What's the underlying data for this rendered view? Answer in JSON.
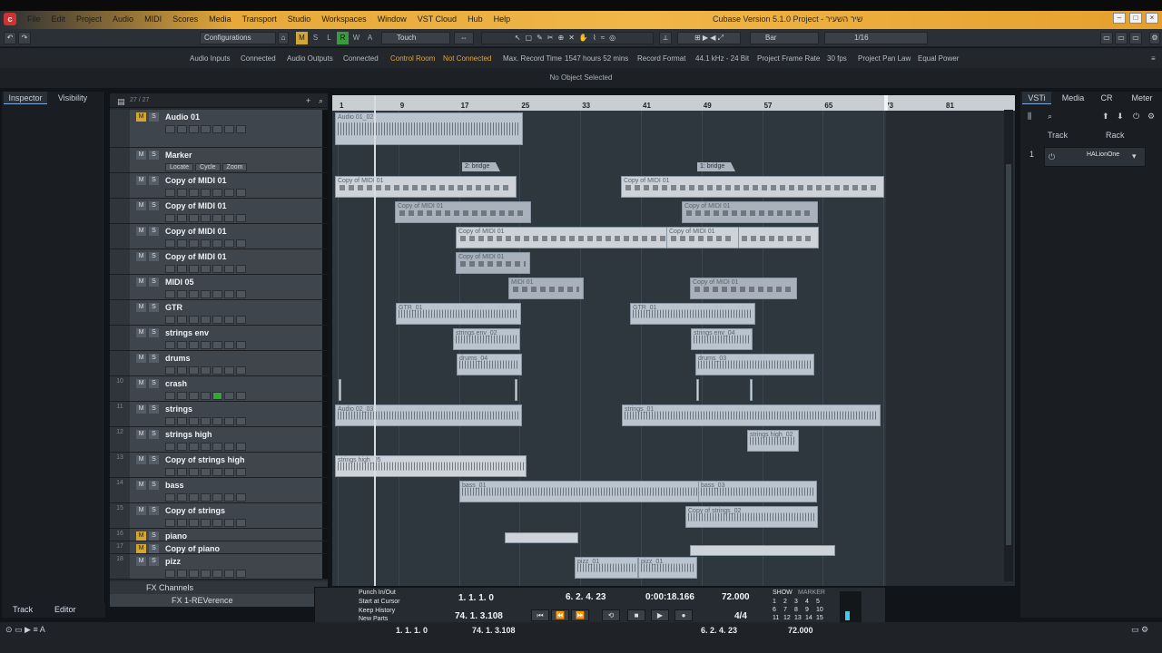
{
  "window": {
    "title": "Cubase Version 5.1.0 Project - שיר השעיר",
    "app_icon": "cubase-icon"
  },
  "menu": [
    "File",
    "Edit",
    "Project",
    "Audio",
    "MIDI",
    "Scores",
    "Media",
    "Transport",
    "Studio",
    "Workspaces",
    "Window",
    "VST Cloud",
    "Hub",
    "Help"
  ],
  "toolbar": {
    "configurations": "Configurations",
    "toggles": [
      "M",
      "S",
      "L",
      "R",
      "W",
      "A"
    ],
    "automation_mode": "Touch",
    "grid_type": "Bar",
    "quantize": "1/16"
  },
  "status": {
    "audio_inputs_label": "Audio Inputs",
    "audio_inputs_value": "Connected",
    "audio_outputs_label": "Audio Outputs",
    "audio_outputs_value": "Connected",
    "control_room_label": "Control Room",
    "control_room_value": "Not Connected",
    "max_record_label": "Max. Record Time",
    "max_record_value": "1547 hours 52 mins",
    "record_format_label": "Record Format",
    "record_format_value": "44.1 kHz - 24 Bit",
    "frame_rate_label": "Project Frame Rate",
    "frame_rate_value": "30 fps",
    "pan_law_label": "Project Pan Law",
    "pan_law_value": "Equal Power",
    "info": "No Object Selected"
  },
  "left_zone": {
    "tabs": [
      "Inspector",
      "Visibility"
    ],
    "bottom_tabs": [
      "Track",
      "Editor"
    ]
  },
  "track_list": {
    "count": "27 / 27",
    "tracks": [
      {
        "num": "",
        "name": "Audio 01",
        "m_on": true
      },
      {
        "num": "",
        "name": "Marker",
        "m_on": false
      },
      {
        "num": "",
        "name": "Copy of MIDI 01",
        "m_on": false
      },
      {
        "num": "",
        "name": "Copy of MIDI 01",
        "m_on": false
      },
      {
        "num": "",
        "name": "Copy of MIDI 01",
        "m_on": false
      },
      {
        "num": "",
        "name": "Copy of MIDI 01",
        "m_on": false
      },
      {
        "num": "",
        "name": "MIDI 05",
        "m_on": false
      },
      {
        "num": "",
        "name": "GTR",
        "m_on": false
      },
      {
        "num": "",
        "name": "strings env",
        "m_on": false
      },
      {
        "num": "",
        "name": "drums",
        "m_on": false
      },
      {
        "num": "10",
        "name": "crash",
        "m_on": false
      },
      {
        "num": "11",
        "name": "strings",
        "m_on": false
      },
      {
        "num": "12",
        "name": "strings high",
        "m_on": false
      },
      {
        "num": "13",
        "name": "Copy of strings high",
        "m_on": false
      },
      {
        "num": "14",
        "name": "bass",
        "m_on": false
      },
      {
        "num": "15",
        "name": "Copy of strings",
        "m_on": false
      },
      {
        "num": "16",
        "name": "piano",
        "m_on": true
      },
      {
        "num": "17",
        "name": "Copy of piano",
        "m_on": true
      },
      {
        "num": "18",
        "name": "pizz",
        "m_on": false
      }
    ],
    "marker_buttons": [
      "Locate",
      "Cycle",
      "Zoom"
    ],
    "folder_fx": "FX Channels",
    "fx_track": "FX 1-REVerence"
  },
  "ruler": [
    "1",
    "9",
    "17",
    "25",
    "33",
    "41",
    "49",
    "57",
    "65",
    "73",
    "81"
  ],
  "markers": [
    {
      "label": "2: bridge"
    },
    {
      "label": "1: bridge"
    }
  ],
  "events": {
    "audio01": "Audio 01_02",
    "copy1a": "Copy of MIDI 01",
    "copy1b": "Copy of MIDI 01",
    "copy2a": "Copy of MIDI 01",
    "copy2b": "Copy of MIDI 01",
    "copy3a": "Copy of MIDI 01",
    "copy3b": "Copy of MIDI 01",
    "copy4a": "Copy of MIDI 01",
    "midi05a": "MIDI 01",
    "midi05b": "Copy of MIDI 01",
    "gtr1": "GTR_01",
    "gtr2": "GTR_01",
    "senv1": "strings env_02",
    "senv2": "strings env_04",
    "drums1": "drums_04",
    "drums2": "drums_03",
    "str1": "Audio 02_03",
    "str2": "strings_01",
    "sh1": "strings high_02",
    "csh1": "strings high_05",
    "bass1": "bass_01",
    "bass2": "bass_03",
    "cos1": "Copy of strings_02",
    "pizz1": "pizz_01",
    "pizz2": "pizz_01"
  },
  "right_zone": {
    "tabs": [
      "VSTi",
      "Media",
      "CR",
      "Meter"
    ],
    "header_track": "Track",
    "header_rack": "Rack",
    "slot_num": "1",
    "slot_name": "HALionOne"
  },
  "transport": {
    "punch": "Punch In/Out",
    "start_cursor": "Start at Cursor",
    "keep_history": "Keep History",
    "new_parts": "New Parts",
    "left_locator": "1. 1. 1.   0",
    "right_locator": "74. 1. 3.108",
    "position_bars": "6. 2. 4. 23",
    "position_time": "0:00:18.166",
    "tempo": "72.000",
    "signature": "4/4",
    "show": "SHOW",
    "marker": "MARKER",
    "marker_nums": [
      "1",
      "2",
      "3",
      "4",
      "5",
      "6",
      "7",
      "8",
      "9",
      "10",
      "11",
      "12",
      "13",
      "14",
      "15"
    ]
  },
  "bottom": {
    "left_locator": "1. 1. 1.   0",
    "right_locator": "74. 1. 3.108",
    "position": "6. 2. 4. 23",
    "tempo": "72.000"
  }
}
